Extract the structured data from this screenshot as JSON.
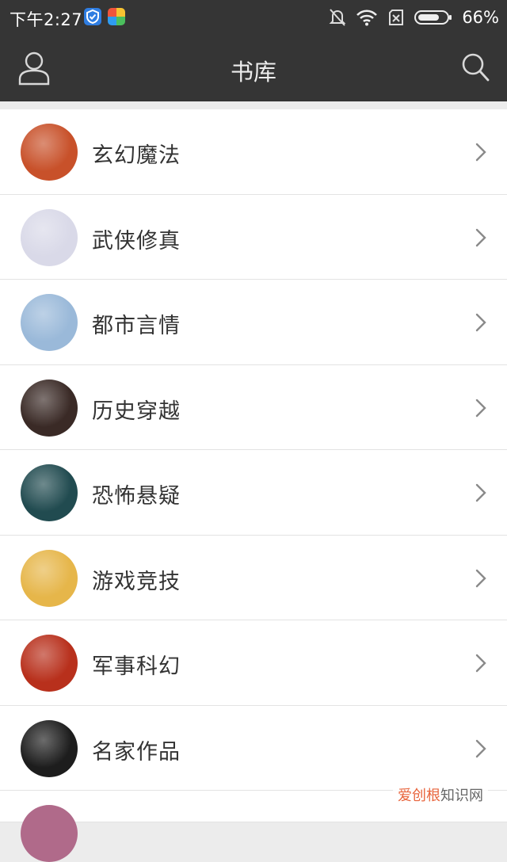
{
  "status_bar": {
    "time": "下午2:27",
    "battery": "66%",
    "icons": [
      "shield-app-icon",
      "colorful-app-icon",
      "bell-muted-icon",
      "wifi-icon",
      "sim-cross-icon",
      "battery-icon"
    ]
  },
  "nav": {
    "title": "书库",
    "left_icon": "user-icon",
    "right_icon": "search-icon"
  },
  "categories": [
    {
      "label": "玄幻魔法",
      "cover_color": "#c8512a"
    },
    {
      "label": "武侠修真",
      "cover_color": "#d9d9e8"
    },
    {
      "label": "都市言情",
      "cover_color": "#9ab9d9"
    },
    {
      "label": "历史穿越",
      "cover_color": "#3a2a26"
    },
    {
      "label": "恐怖悬疑",
      "cover_color": "#214b50"
    },
    {
      "label": "游戏竞技",
      "cover_color": "#e6b64a"
    },
    {
      "label": "军事科幻",
      "cover_color": "#b8301c"
    },
    {
      "label": "名家作品",
      "cover_color": "#1d1d1d"
    }
  ],
  "watermark": {
    "part1": "爱创根",
    "part2": "知识网"
  },
  "colors": {
    "nav_bg": "#353535",
    "row_bg": "#ffffff",
    "divider": "#e3e3e3"
  }
}
